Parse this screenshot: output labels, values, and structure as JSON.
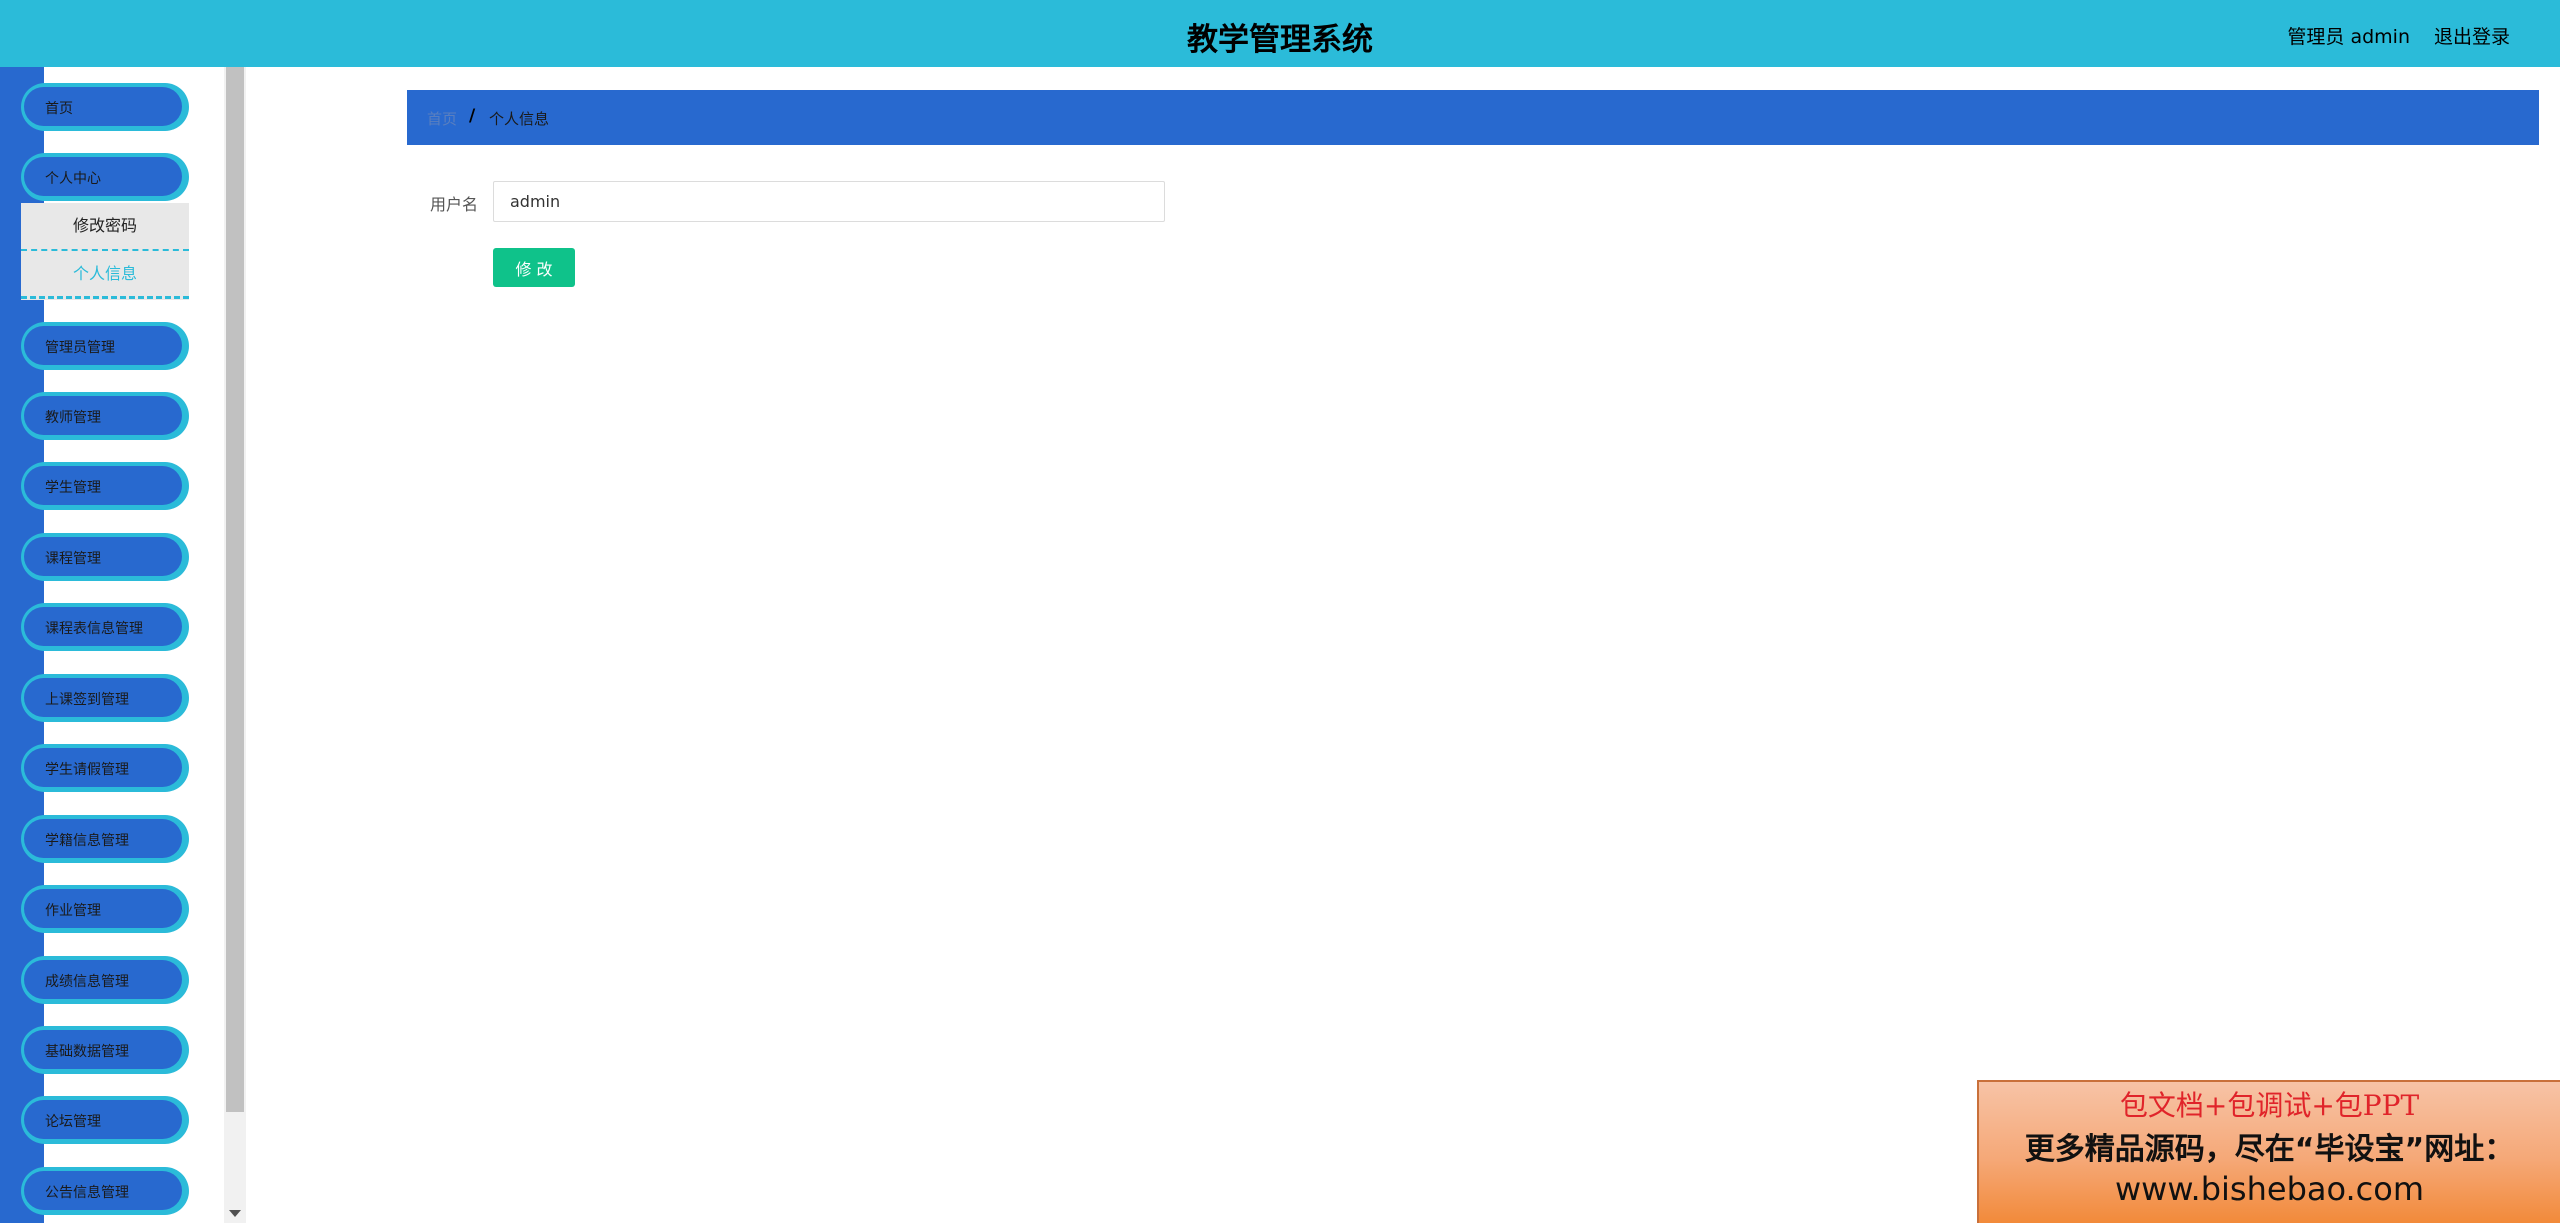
{
  "header": {
    "title": "教学管理系统",
    "user": "管理员 admin",
    "logout": "退出登录"
  },
  "sidebar": {
    "items": [
      {
        "label": "首页"
      },
      {
        "label": "个人中心"
      },
      {
        "label": "管理员管理"
      },
      {
        "label": "教师管理"
      },
      {
        "label": "学生管理"
      },
      {
        "label": "课程管理"
      },
      {
        "label": "课程表信息管理"
      },
      {
        "label": "上课签到管理"
      },
      {
        "label": "学生请假管理"
      },
      {
        "label": "学籍信息管理"
      },
      {
        "label": "作业管理"
      },
      {
        "label": "成绩信息管理"
      },
      {
        "label": "基础数据管理"
      },
      {
        "label": "论坛管理"
      },
      {
        "label": "公告信息管理"
      }
    ],
    "submenu": {
      "change_password": "修改密码",
      "personal_info": "个人信息"
    }
  },
  "breadcrumb": {
    "home": "首页",
    "separator": "/",
    "current": "个人信息"
  },
  "form": {
    "username_label": "用户名",
    "username_value": "admin",
    "submit_label": "修 改"
  },
  "ad": {
    "line1": "包文档+包调试+包PPT",
    "line2": "更多精品源码，尽在“毕设宝”网址：",
    "line3": "www.bishebao.com"
  },
  "colors": {
    "header_bg": "#2bbbd9",
    "sidebar_bg": "#2869cf",
    "breadcrumb_bg": "#2869cf",
    "button_bg": "#0fc28a"
  }
}
